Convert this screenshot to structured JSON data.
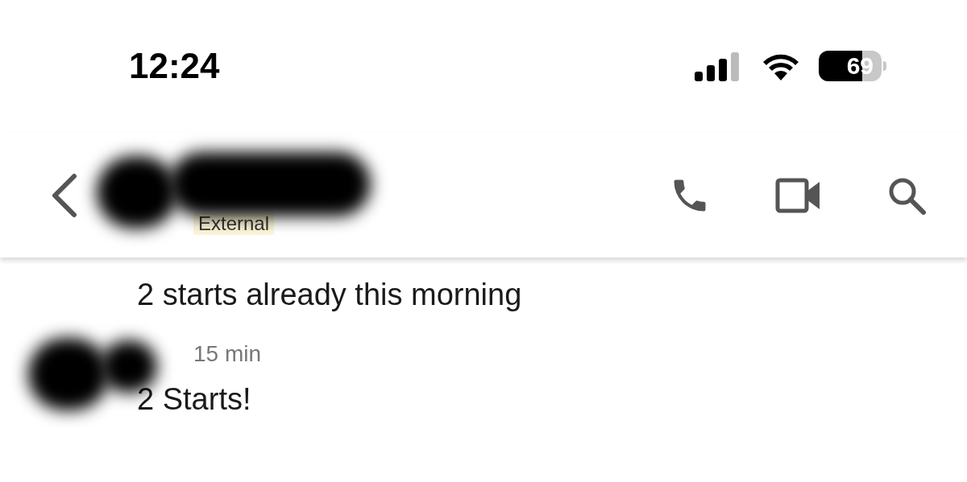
{
  "status_bar": {
    "time": "12:24",
    "battery": "69"
  },
  "header": {
    "badge": "External"
  },
  "messages": [
    {
      "kind": "text",
      "text": "2 starts already this morning"
    },
    {
      "kind": "post",
      "time": "15 min",
      "text": "2 Starts!"
    }
  ]
}
